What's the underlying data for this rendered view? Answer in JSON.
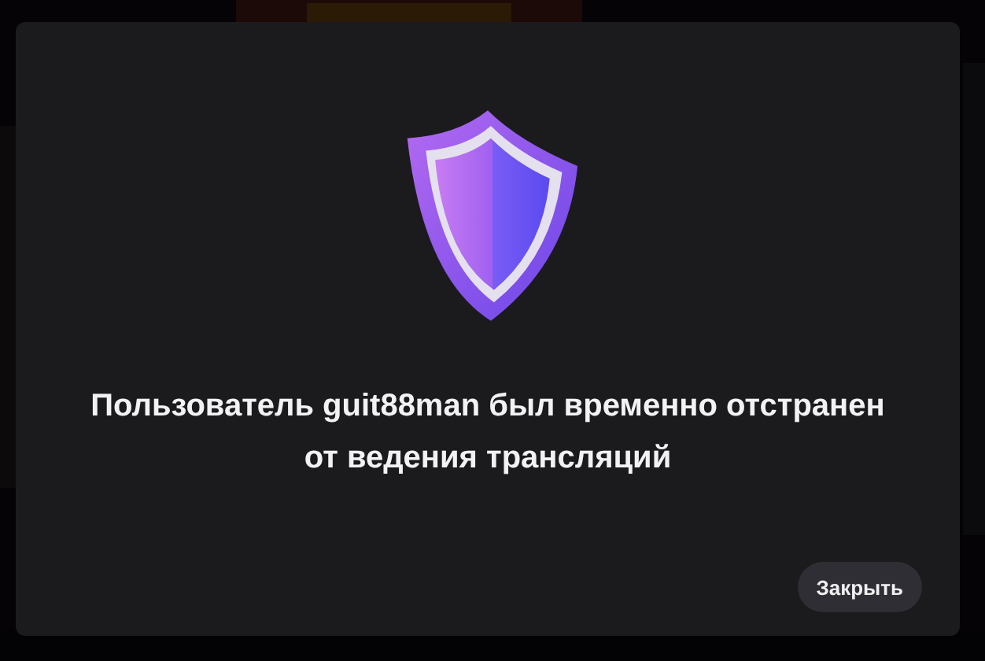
{
  "dialog": {
    "message": "Пользователь guit88man был временно отстранен от ведения трансляций",
    "buttons": [
      {
        "label": "Закрыть"
      }
    ]
  }
}
